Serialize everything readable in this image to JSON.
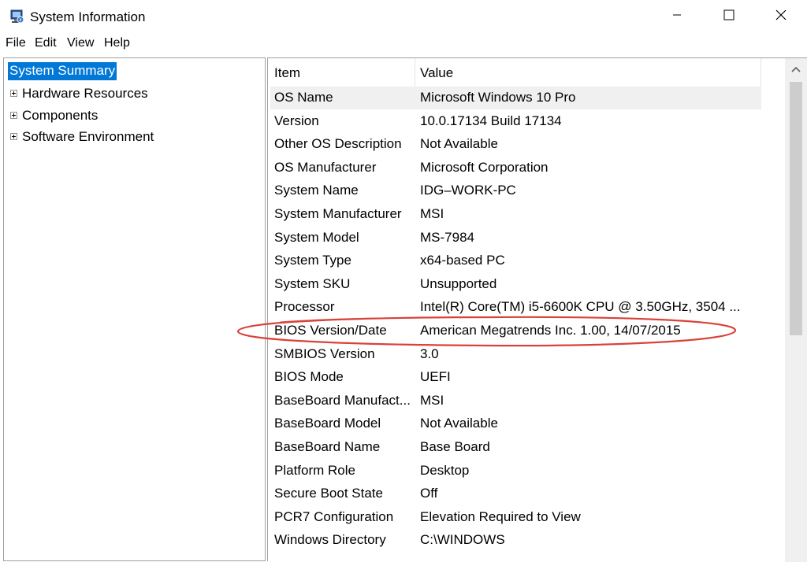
{
  "window": {
    "title": "System Information",
    "icon": "system-information-icon",
    "controls": [
      "minimize-icon",
      "maximize-icon",
      "close-icon"
    ]
  },
  "menu": [
    "File",
    "Edit",
    "View",
    "Help"
  ],
  "tree": {
    "selected": "System Summary",
    "items": [
      "Hardware Resources",
      "Components",
      "Software Environment"
    ]
  },
  "table": {
    "headers": {
      "item": "Item",
      "value": "Value"
    },
    "rows": [
      {
        "item": "OS Name",
        "value": "Microsoft Windows 10 Pro"
      },
      {
        "item": "Version",
        "value": "10.0.17134 Build 17134"
      },
      {
        "item": "Other OS Description",
        "value": "Not Available"
      },
      {
        "item": "OS Manufacturer",
        "value": "Microsoft Corporation"
      },
      {
        "item": "System Name",
        "value": "IDG–WORK-PC"
      },
      {
        "item": "System Manufacturer",
        "value": "MSI"
      },
      {
        "item": "System Model",
        "value": "MS-7984"
      },
      {
        "item": "System Type",
        "value": "x64-based PC"
      },
      {
        "item": "System SKU",
        "value": "Unsupported"
      },
      {
        "item": "Processor",
        "value": "Intel(R) Core(TM) i5-6600K CPU @ 3.50GHz, 3504 ..."
      },
      {
        "item": "BIOS Version/Date",
        "value": "American Megatrends Inc. 1.00, 14/07/2015"
      },
      {
        "item": "SMBIOS Version",
        "value": "3.0"
      },
      {
        "item": "BIOS Mode",
        "value": "UEFI"
      },
      {
        "item": "BaseBoard Manufact...",
        "value": "MSI"
      },
      {
        "item": "BaseBoard Model",
        "value": "Not Available"
      },
      {
        "item": "BaseBoard Name",
        "value": "Base Board"
      },
      {
        "item": "Platform Role",
        "value": "Desktop"
      },
      {
        "item": "Secure Boot State",
        "value": "Off"
      },
      {
        "item": "PCR7 Configuration",
        "value": "Elevation Required to View"
      },
      {
        "item": "Windows Directory",
        "value": "C:\\WINDOWS"
      }
    ]
  },
  "colors": {
    "selection": "#0078d7",
    "highlight_annotation": "#d9423a",
    "row_hover": "#f0f0f0"
  }
}
